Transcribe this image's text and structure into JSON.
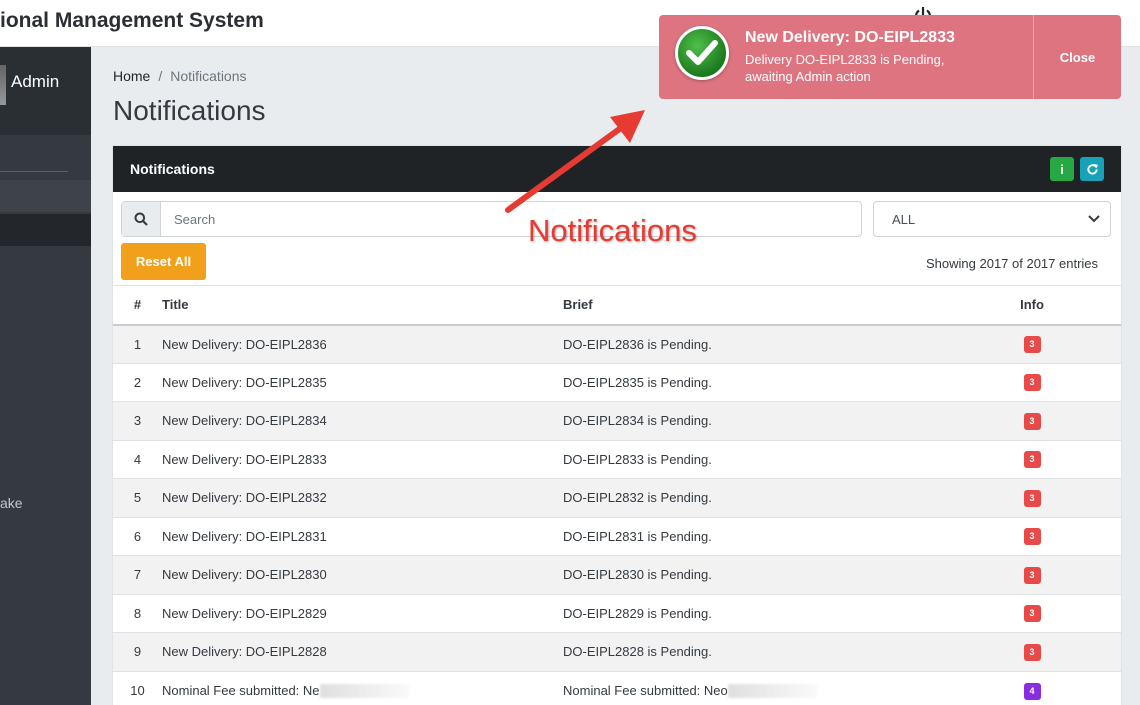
{
  "app": {
    "title": "ional Management System"
  },
  "sidebar": {
    "user_label": "Admin",
    "partial_item": "ake"
  },
  "breadcrumb": {
    "home": "Home",
    "current": "Notifications"
  },
  "page": {
    "title": "Notifications"
  },
  "card": {
    "title": "Notifications",
    "info_icon": "i",
    "search_placeholder": "Search",
    "filter_value": "ALL",
    "reset_label": "Reset All",
    "entries_text": "Showing 2017 of 2017 entries"
  },
  "table": {
    "headers": {
      "num": "#",
      "title": "Title",
      "brief": "Brief",
      "info": "Info"
    },
    "rows": [
      {
        "num": "1",
        "title": "New Delivery: DO-EIPL2836",
        "brief": "DO-EIPL2836 is Pending.",
        "info": "3",
        "info_color": "#e84a4a"
      },
      {
        "num": "2",
        "title": "New Delivery: DO-EIPL2835",
        "brief": "DO-EIPL2835 is Pending.",
        "info": "3",
        "info_color": "#e84a4a"
      },
      {
        "num": "3",
        "title": "New Delivery: DO-EIPL2834",
        "brief": "DO-EIPL2834 is Pending.",
        "info": "3",
        "info_color": "#e84a4a"
      },
      {
        "num": "4",
        "title": "New Delivery: DO-EIPL2833",
        "brief": "DO-EIPL2833 is Pending.",
        "info": "3",
        "info_color": "#e84a4a"
      },
      {
        "num": "5",
        "title": "New Delivery: DO-EIPL2832",
        "brief": "DO-EIPL2832 is Pending.",
        "info": "3",
        "info_color": "#e84a4a"
      },
      {
        "num": "6",
        "title": "New Delivery: DO-EIPL2831",
        "brief": "DO-EIPL2831 is Pending.",
        "info": "3",
        "info_color": "#e84a4a"
      },
      {
        "num": "7",
        "title": "New Delivery: DO-EIPL2830",
        "brief": "DO-EIPL2830 is Pending.",
        "info": "3",
        "info_color": "#e84a4a"
      },
      {
        "num": "8",
        "title": "New Delivery: DO-EIPL2829",
        "brief": "DO-EIPL2829 is Pending.",
        "info": "3",
        "info_color": "#e84a4a"
      },
      {
        "num": "9",
        "title": "New Delivery: DO-EIPL2828",
        "brief": "DO-EIPL2828 is Pending.",
        "info": "3",
        "info_color": "#e84a4a"
      },
      {
        "num": "10",
        "title": "Nominal Fee submitted: Ne",
        "brief": "Nominal Fee submitted: Neo",
        "info": "4",
        "info_color": "#8a2ce0"
      }
    ]
  },
  "toast": {
    "title": "New Delivery: DO-EIPL2833",
    "message": "Delivery DO-EIPL2833 is Pending, awaiting Admin action",
    "close_label": "Close",
    "bg_color": "#de7480"
  },
  "annotation": {
    "text": "Notifications",
    "color": "#e63b33"
  }
}
